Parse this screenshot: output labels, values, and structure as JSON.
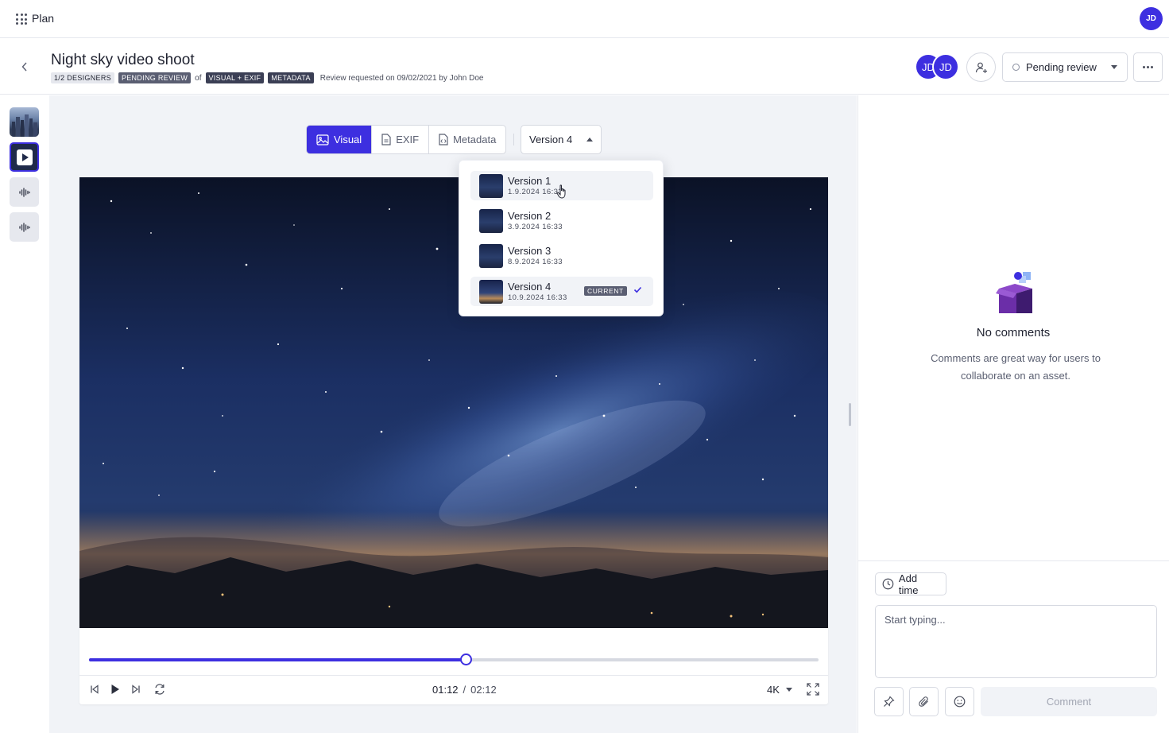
{
  "app": {
    "name": "Plan",
    "user_initials": "JD"
  },
  "header": {
    "title": "Night sky video shoot",
    "tags": {
      "designers": "1/2 DESIGNERS",
      "status": "PENDING REVIEW",
      "of": "of",
      "visual_exif": "VISUAL + EXIF",
      "metadata": "METADATA"
    },
    "review_text": "Review requested on 09/02/2021 by John Doe",
    "avatars": [
      "JD",
      "JD"
    ],
    "status_label": "Pending review"
  },
  "left_strip": {
    "items": [
      {
        "type": "image",
        "icon": "image-thumbnail"
      },
      {
        "type": "video",
        "icon": "play-icon",
        "selected": true
      },
      {
        "type": "audio",
        "icon": "audio-wave-icon"
      },
      {
        "type": "audio",
        "icon": "audio-wave-icon"
      }
    ]
  },
  "view_tabs": {
    "items": [
      {
        "label": "Visual",
        "icon": "image-icon",
        "active": true
      },
      {
        "label": "EXIF",
        "icon": "document-icon",
        "active": false
      },
      {
        "label": "Metadata",
        "icon": "code-file-icon",
        "active": false
      }
    ],
    "version_selected": "Version 4"
  },
  "version_dropdown": {
    "items": [
      {
        "label": "Version 1",
        "date": "1.9.2024 16:33",
        "hover": true
      },
      {
        "label": "Version 2",
        "date": "3.9.2024 16:33"
      },
      {
        "label": "Version 3",
        "date": "8.9.2024 16:33"
      },
      {
        "label": "Version 4",
        "date": "10.9.2024 16:33",
        "badge": "CURRENT",
        "checked": true
      }
    ]
  },
  "player": {
    "current_time": "01:12",
    "separator": "/",
    "duration": "02:12",
    "progress": 0.516,
    "quality": "4K"
  },
  "comments": {
    "empty_title": "No comments",
    "empty_desc": "Comments are great way for users to collaborate on an asset.",
    "add_time_label": "Add time",
    "input_placeholder": "Start typing...",
    "comment_button": "Comment"
  },
  "colors": {
    "accent": "#3d2fe0",
    "tag_dark": "#5a5e72",
    "panel_bg": "#f1f3f7"
  }
}
